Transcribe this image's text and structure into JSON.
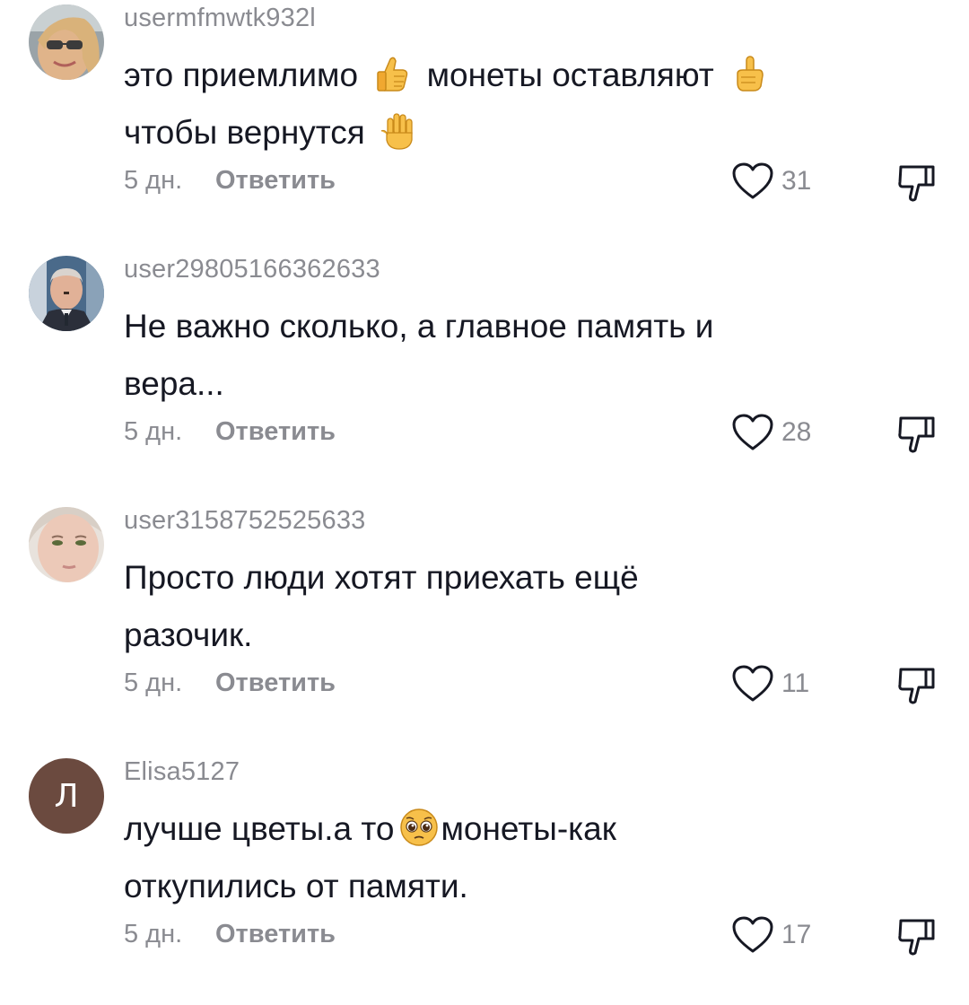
{
  "comments": [
    {
      "username": "usermfmwtk932l",
      "avatar_icon": "user-photo-sunglasses",
      "line1_a": "это приемлимо",
      "emoji1": "thumbs-up-icon",
      "line1_b": "монеты оставляют",
      "emoji2": "index-pointing-up-icon",
      "line2_a": "чтобы вернутся",
      "emoji3": "raised-hand-icon",
      "time": "5 дн.",
      "reply_label": "Ответить",
      "likes": "31"
    },
    {
      "username": "user29805166362633",
      "avatar_icon": "user-photo-man-suit",
      "line1": "Не важно сколько, а главное память и",
      "line2": "вера...",
      "time": "5 дн.",
      "reply_label": "Ответить",
      "likes": "28"
    },
    {
      "username": "user3158752525633",
      "avatar_icon": "user-photo-woman",
      "line1": "Просто люди хотят приехать ещё",
      "line2": "разочик.",
      "time": "5 дн.",
      "reply_label": "Ответить",
      "likes": "11"
    },
    {
      "username": "Elisa5127",
      "avatar_letter": "Л",
      "avatar_color": "#6b4a3f",
      "line1_a": "лучше цветы.а то",
      "emoji1": "pleading-face-icon",
      "line1_b": "монеты-как",
      "line2": "откупились от памяти.",
      "time": "5 дн.",
      "reply_label": "Ответить",
      "likes": "17"
    }
  ],
  "colors": {
    "text": "#161823",
    "secondary": "#8a8b91",
    "icon": "#161823"
  }
}
